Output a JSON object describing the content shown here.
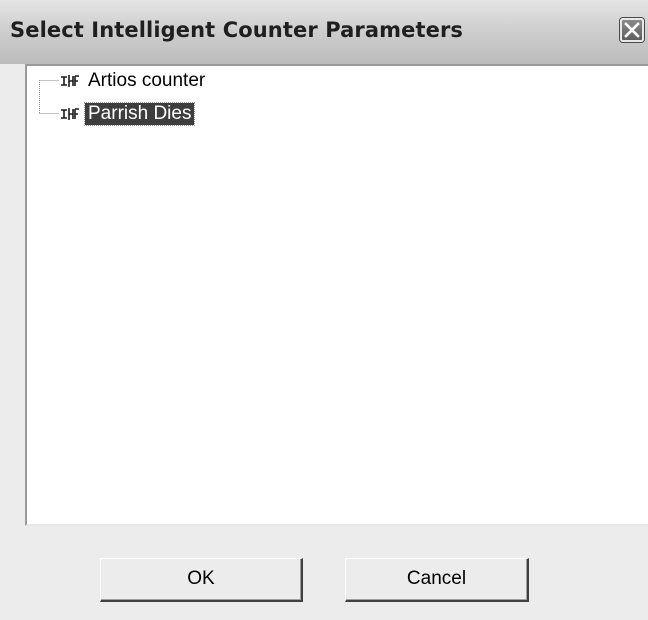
{
  "window": {
    "title": "Select Intelligent Counter Parameters",
    "close_icon": "close-icon"
  },
  "tree": {
    "node_icon": "tree-node-icon",
    "items": [
      {
        "label": "Artios counter",
        "selected": false
      },
      {
        "label": "Parrish Dies",
        "selected": true
      }
    ]
  },
  "buttons": {
    "ok_label": "OK",
    "cancel_label": "Cancel"
  }
}
